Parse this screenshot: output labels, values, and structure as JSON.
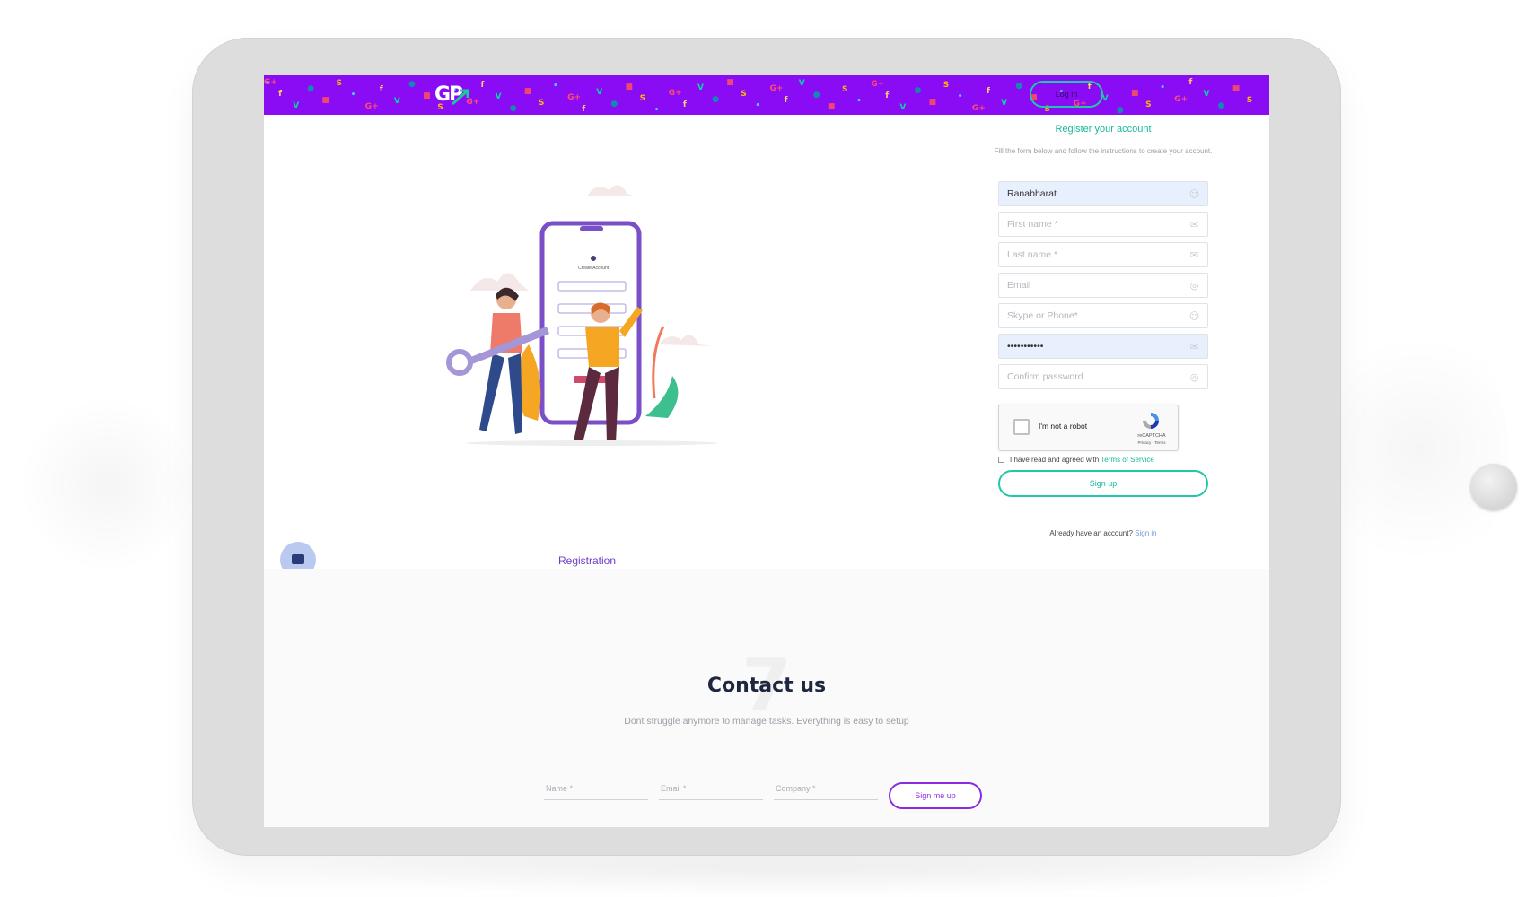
{
  "header": {
    "logo_text": "GP",
    "login_label": "Log in",
    "brand_color": "#8a0cf5",
    "accent_color": "#20c9a6"
  },
  "illustration": {
    "caption": "Registration",
    "phone_screen_title": "Create Account"
  },
  "register": {
    "title": "Register your account",
    "subtitle": "Fill the form below and follow the instructions to create your account.",
    "fields": [
      {
        "value": "Ranabharat",
        "placeholder": "",
        "icon": "user-icon"
      },
      {
        "value": "",
        "placeholder": "First name *",
        "icon": "envelope-icon"
      },
      {
        "value": "",
        "placeholder": "Last name *",
        "icon": "envelope-icon"
      },
      {
        "value": "",
        "placeholder": "Email",
        "icon": "globe-icon"
      },
      {
        "value": "",
        "placeholder": "Skype or Phone*",
        "icon": "user-icon"
      },
      {
        "value": "•••••••••••",
        "placeholder": "",
        "icon": "envelope-icon"
      },
      {
        "value": "",
        "placeholder": "Confirm password",
        "icon": "globe-icon"
      }
    ],
    "captcha": {
      "label": "I'm not a robot",
      "brand": "reCAPTCHA",
      "links": "Privacy - Terms"
    },
    "terms_prefix": "I have read and agreed with",
    "terms_link": "Terms of Service",
    "signup_label": "Sign up",
    "already_text": "Already have an account?",
    "signin_link": "Sign in"
  },
  "contact": {
    "watermark": "7",
    "title": "Contact us",
    "subtitle": "Dont struggle anymore to manage tasks. Everything is easy to setup",
    "fields": [
      {
        "placeholder": "Name *"
      },
      {
        "placeholder": "Email *"
      },
      {
        "placeholder": "Company *"
      }
    ],
    "button_label": "Sign me up"
  }
}
